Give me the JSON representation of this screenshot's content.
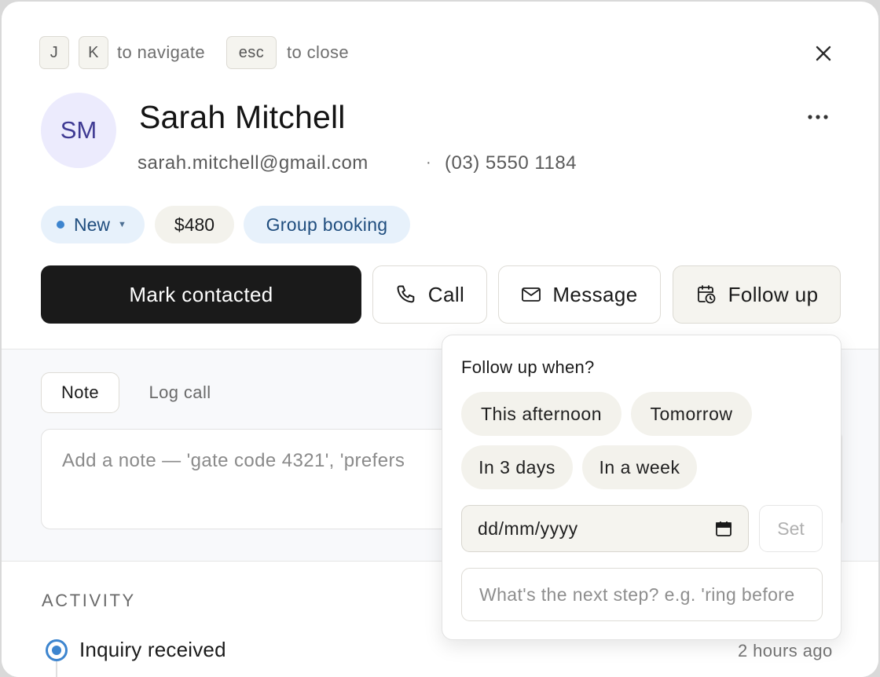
{
  "shortcuts": {
    "key_j": "J",
    "key_k": "K",
    "navigate_hint": "to navigate",
    "key_esc": "esc",
    "close_hint": "to close"
  },
  "contact": {
    "initials": "SM",
    "name": "Sarah Mitchell",
    "email": "sarah.mitchell@gmail.com",
    "separator": "·",
    "phone": "(03) 5550 1184"
  },
  "tags": {
    "status": "New",
    "amount": "$480",
    "category": "Group booking"
  },
  "actions": {
    "primary": "Mark contacted",
    "call": "Call",
    "message": "Message",
    "follow_up": "Follow up"
  },
  "composer": {
    "tabs": [
      "Note",
      "Log call"
    ],
    "active_tab": "Note",
    "note_placeholder": "Add a note — 'gate code 4321', 'prefers"
  },
  "activity": {
    "heading": "ACTIVITY",
    "items": [
      {
        "title": "Inquiry received",
        "time": "2 hours ago"
      }
    ]
  },
  "follow_up_popover": {
    "title": "Follow up when?",
    "options": [
      "This afternoon",
      "Tomorrow",
      "In 3 days",
      "In a week"
    ],
    "date_placeholder": "dd/mm/yyyy",
    "set_label": "Set",
    "step_placeholder": "What's the next step? e.g. 'ring before"
  },
  "colors": {
    "primary_button": "#1a1a1a",
    "status_dot": "#3d85cf",
    "tag_background": "#e7f1fb",
    "avatar_background": "#ecebfd"
  },
  "icons": {
    "close": "close-icon",
    "more": "more-horizontal-icon",
    "call": "phone-icon",
    "message": "mail-icon",
    "follow_up": "calendar-clock-icon",
    "date": "calendar-icon",
    "activity": "radio-dot-icon"
  }
}
